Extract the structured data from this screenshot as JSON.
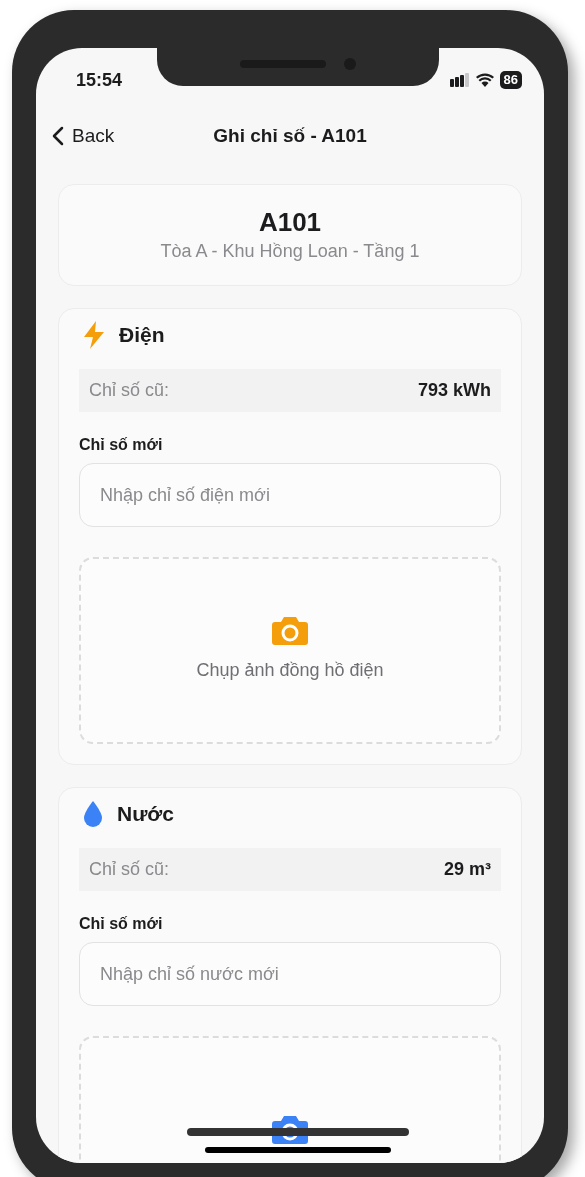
{
  "status_bar": {
    "time": "15:54",
    "battery": "86"
  },
  "nav": {
    "back": "Back",
    "title": "Ghi chỉ số - A101"
  },
  "room": {
    "name": "A101",
    "location": "Tòa A - Khu Hồng Loan - Tầng 1"
  },
  "meters": [
    {
      "kind": "electric",
      "color": "#f59e0b",
      "title": "Điện",
      "old_label": "Chỉ số cũ:",
      "old_value": "793 kWh",
      "new_label": "Chỉ số mới",
      "placeholder": "Nhập chỉ số điện mới",
      "photo_label": "Chụp ảnh đồng hồ điện"
    },
    {
      "kind": "water",
      "color": "#3b82f6",
      "title": "Nước",
      "old_label": "Chỉ số cũ:",
      "old_value": "29 m³",
      "new_label": "Chỉ số mới",
      "placeholder": "Nhập chỉ số nước mới"
    }
  ]
}
